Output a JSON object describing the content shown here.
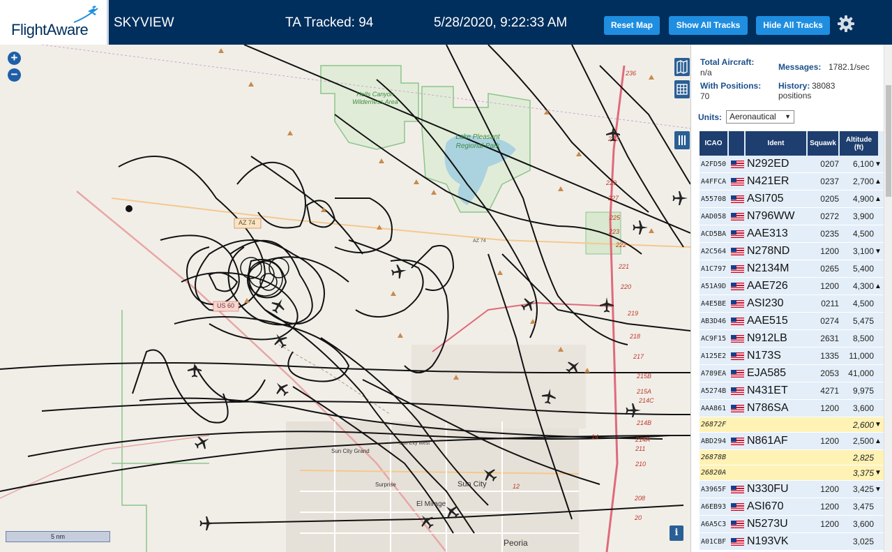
{
  "header": {
    "logo_text": "FlightAware",
    "app_title": "SKYVIEW",
    "tracked": "TA Tracked: 94",
    "datetime": "5/28/2020, 9:22:33 AM",
    "btn_reset": "Reset Map",
    "btn_show": "Show All Tracks",
    "btn_hide": "Hide All Tracks"
  },
  "map": {
    "zoom_in": "+",
    "zoom_out": "−",
    "scale_label": "5 nm",
    "info": "i",
    "labels": {
      "hells_canyon": "Hells Canyon Wilderness Area",
      "lake_pleasant": "Lake Pleasant Regional Park",
      "az74": "AZ 74",
      "az74b": "AZ 74",
      "us60": "US 60",
      "sun_city": "Sun City",
      "sun_city_grand": "Sun City Grand",
      "surprise": "Surprise",
      "el_mirage": "El Mirage",
      "peoria": "Peoria",
      "sun_city_west": "Sun City West"
    },
    "mile_markers": [
      "236",
      "232",
      "229",
      "227",
      "225",
      "223",
      "222",
      "221",
      "220",
      "219",
      "218",
      "217",
      "215B",
      "215A",
      "214C",
      "214B",
      "214A",
      "211",
      "210",
      "208",
      "20",
      "14",
      "12"
    ]
  },
  "panel": {
    "total_label": "Total Aircraft:",
    "total_val": "n/a",
    "positions_label": "With Positions:",
    "positions_val": "70",
    "messages_label": "Messages:",
    "messages_val": "1782.1/sec",
    "history_label": "History:",
    "history_val": "38083 positions",
    "units_label": "Units:",
    "units_value": "Aeronautical",
    "columns": [
      "ICAO",
      "",
      "Ident",
      "Squawk",
      "Altitude (ft)"
    ],
    "rows": [
      {
        "icao": "A2FD50",
        "ident": "N292ED",
        "squawk": "0207",
        "alt": "6,100",
        "vr": "▼",
        "mlat": false
      },
      {
        "icao": "A4FFCA",
        "ident": "N421ER",
        "squawk": "0237",
        "alt": "2,700",
        "vr": "▲",
        "mlat": false
      },
      {
        "icao": "A55708",
        "ident": "ASI705",
        "squawk": "0205",
        "alt": "4,900",
        "vr": "▲",
        "mlat": false
      },
      {
        "icao": "AAD058",
        "ident": "N796WW",
        "squawk": "0272",
        "alt": "3,900",
        "vr": "",
        "mlat": false
      },
      {
        "icao": "ACD5BA",
        "ident": "AAE313",
        "squawk": "0235",
        "alt": "4,500",
        "vr": "",
        "mlat": false
      },
      {
        "icao": "A2C564",
        "ident": "N278ND",
        "squawk": "1200",
        "alt": "3,100",
        "vr": "▼",
        "mlat": false
      },
      {
        "icao": "A1C797",
        "ident": "N2134M",
        "squawk": "0265",
        "alt": "5,400",
        "vr": "",
        "mlat": false
      },
      {
        "icao": "A51A9D",
        "ident": "AAE726",
        "squawk": "1200",
        "alt": "4,300",
        "vr": "▲",
        "mlat": false
      },
      {
        "icao": "A4E5BE",
        "ident": "ASI230",
        "squawk": "0211",
        "alt": "4,500",
        "vr": "",
        "mlat": false
      },
      {
        "icao": "AB3D46",
        "ident": "AAE515",
        "squawk": "0274",
        "alt": "5,475",
        "vr": "",
        "mlat": false
      },
      {
        "icao": "AC9F15",
        "ident": "N912LB",
        "squawk": "2631",
        "alt": "8,500",
        "vr": "",
        "mlat": false
      },
      {
        "icao": "A125E2",
        "ident": "N173S",
        "squawk": "1335",
        "alt": "11,000",
        "vr": "",
        "mlat": false
      },
      {
        "icao": "A789EA",
        "ident": "EJA585",
        "squawk": "2053",
        "alt": "41,000",
        "vr": "",
        "mlat": false
      },
      {
        "icao": "A5274B",
        "ident": "N431ET",
        "squawk": "4271",
        "alt": "9,975",
        "vr": "",
        "mlat": false
      },
      {
        "icao": "AAA861",
        "ident": "N786SA",
        "squawk": "1200",
        "alt": "3,600",
        "vr": "",
        "mlat": false
      },
      {
        "icao": "26872F",
        "ident": "",
        "squawk": "",
        "alt": "2,600",
        "vr": "▼",
        "mlat": true
      },
      {
        "icao": "ABD294",
        "ident": "N861AF",
        "squawk": "1200",
        "alt": "2,500",
        "vr": "▲",
        "mlat": false
      },
      {
        "icao": "26878B",
        "ident": "",
        "squawk": "",
        "alt": "2,825",
        "vr": "",
        "mlat": true
      },
      {
        "icao": "26820A",
        "ident": "",
        "squawk": "",
        "alt": "3,375",
        "vr": "▼",
        "mlat": true
      },
      {
        "icao": "A3965F",
        "ident": "N330FU",
        "squawk": "1200",
        "alt": "3,425",
        "vr": "▼",
        "mlat": false
      },
      {
        "icao": "A6EB93",
        "ident": "ASI670",
        "squawk": "1200",
        "alt": "3,475",
        "vr": "",
        "mlat": false
      },
      {
        "icao": "A6A5C3",
        "ident": "N5273U",
        "squawk": "1200",
        "alt": "3,600",
        "vr": "",
        "mlat": false
      },
      {
        "icao": "A01CBF",
        "ident": "N193VK",
        "squawk": "",
        "alt": "3,025",
        "vr": "",
        "mlat": false
      }
    ]
  },
  "colors": {
    "header_bg": "#002f5d",
    "button": "#1f8ee1",
    "table_header": "#1d3e6e",
    "mlat_row": "#fff2b5",
    "track": "#111111",
    "map_bg": "#f1eee8",
    "park_border": "#8bc58b",
    "lake": "#aad3df"
  },
  "icons": [
    "plane-icon",
    "gear-icon",
    "zoom-in-icon",
    "zoom-out-icon",
    "map-layer-icon",
    "grid-icon",
    "columns-icon",
    "info-icon",
    "flag-icon"
  ]
}
